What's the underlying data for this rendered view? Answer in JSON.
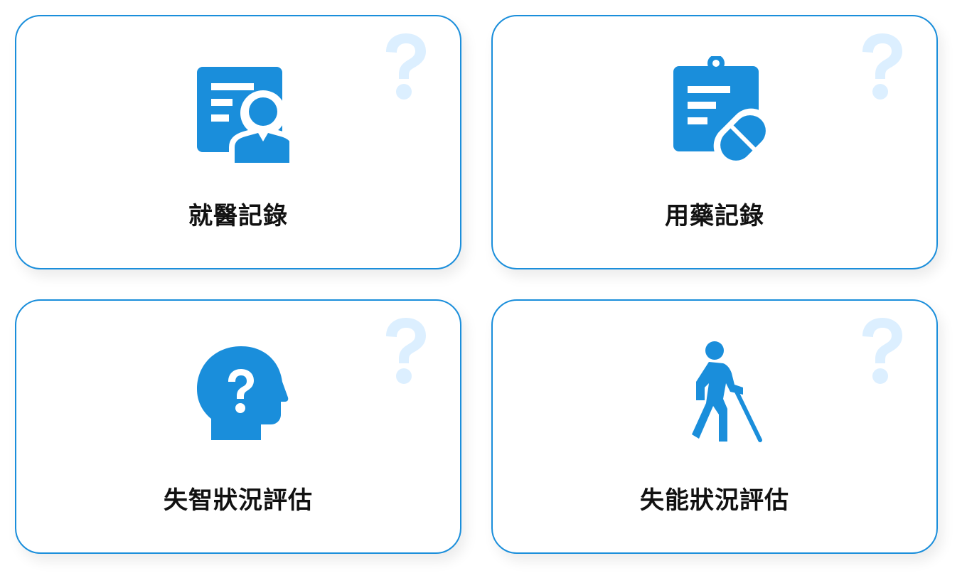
{
  "colors": {
    "accent": "#1a8edb",
    "help_mark": "#dcefff",
    "text": "#111111"
  },
  "cards": [
    {
      "label": "就醫記錄",
      "icon": "medical-record-search-icon"
    },
    {
      "label": "用藥記錄",
      "icon": "clipboard-pill-icon"
    },
    {
      "label": "失智狀況評估",
      "icon": "head-question-icon"
    },
    {
      "label": "失能狀況評估",
      "icon": "person-walking-cane-icon"
    }
  ],
  "help_icon": "question-mark-icon"
}
